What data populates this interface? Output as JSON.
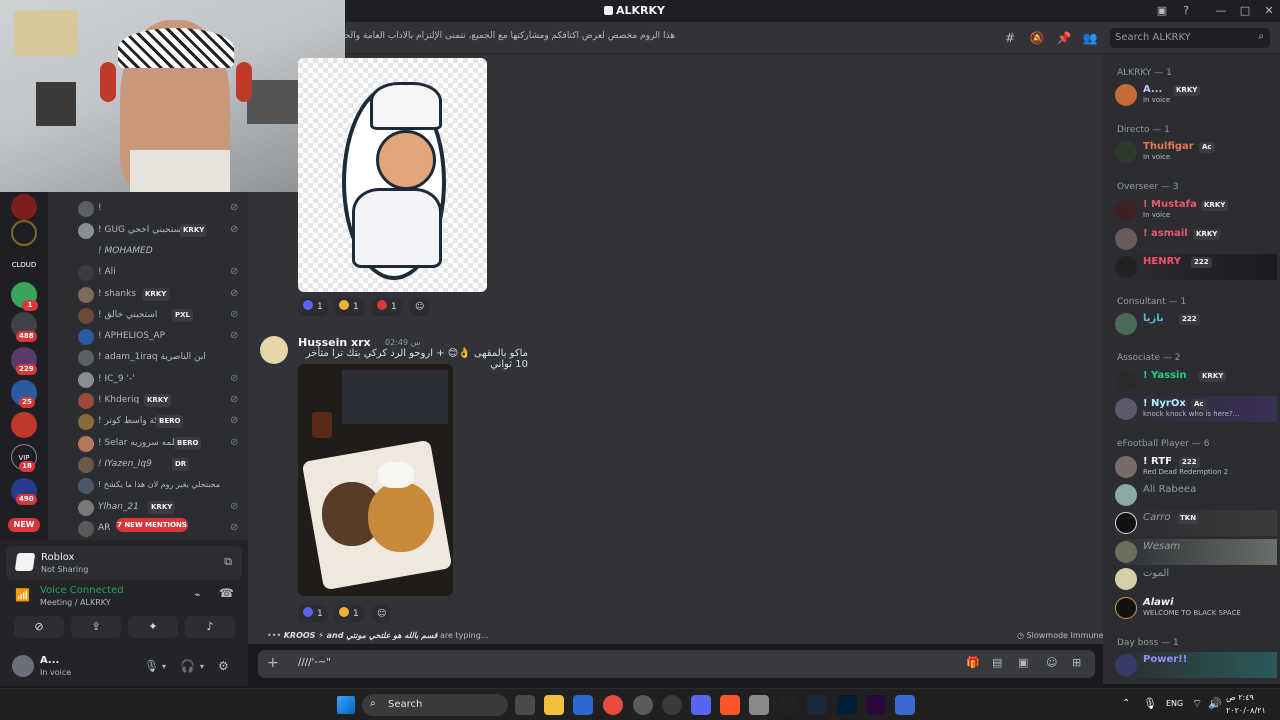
{
  "window": {
    "title": "ALKRKY"
  },
  "header": {
    "topic": "هذا الروم مخصص لعرض اكتافكم ومشاركتها مع الجميع، نتمنى الإلتزام بالآداب العامة والحفاظ على جودة المحتوى",
    "search_placeholder": "Search ALKRKY"
  },
  "guilds": {
    "badges": [
      "1",
      "488",
      "229",
      "25",
      "18",
      "490"
    ],
    "labels": [
      "CLOUD",
      "VIP"
    ],
    "new_label": "NEW"
  },
  "voice_users": [
    {
      "name": "!",
      "tag": ""
    },
    {
      "name": "! GUG استحبني اخحي",
      "tag": "KRKY"
    },
    {
      "name": "! MOHAMED",
      "tag": ""
    },
    {
      "name": "! Ali",
      "tag": ""
    },
    {
      "name": "! shanks",
      "tag": "KRKY"
    },
    {
      "name": "! استحبني خالق",
      "tag": "PXL"
    },
    {
      "name": "! APHELIOS_AP",
      "tag": ""
    },
    {
      "name": "! adam_1iraq ابن الناصرية",
      "tag": ""
    },
    {
      "name": "! IC_9 '-'",
      "tag": ""
    },
    {
      "name": "! Khderiq",
      "tag": "KRKY"
    },
    {
      "name": "! ملكة واسط كوتر",
      "tag": "BERO"
    },
    {
      "name": "! Selar كلمه سروريه",
      "tag": "BERO"
    },
    {
      "name": "! IYazen_Iq9",
      "tag": "DR"
    },
    {
      "name": "! محبتحلي يغير روم لان هذا ما يكشخ",
      "tag": ""
    },
    {
      "name": "Ylhan_21",
      "tag": "KRKY"
    },
    {
      "name": "AR",
      "tag": ""
    }
  ],
  "mentions_pill": "7 NEW MENTIONS",
  "panel": {
    "activity_name": "Roblox",
    "activity_sub": "Not Sharing",
    "voice_status": "Voice Connected",
    "voice_path": "Meeting / ALKRKY",
    "user_name": "A...",
    "user_status": "In voice"
  },
  "messages": {
    "reactions_1": [
      {
        "emoji": "blue",
        "count": "1"
      },
      {
        "emoji": "laugh",
        "count": "1"
      },
      {
        "emoji": "heart",
        "count": "1"
      }
    ],
    "author": "Hussein xrx",
    "time": "س 02:49",
    "text": "ماكو بالمقهى 👌😊 + اروحو الرد كركي بتك ترا متأخر 10 ثواني",
    "reactions_2": [
      {
        "emoji": "blue",
        "count": "1"
      },
      {
        "emoji": "laugh",
        "count": "1"
      }
    ],
    "typing_names": "KROOS ⚡ and قسم بالله هو علتحي مونتي",
    "typing_suffix": "are typing...",
    "slowmode": "Slowmode Immune",
    "composer_value": "////'-~\""
  },
  "members": {
    "roles": [
      {
        "name": "ALKRKY — 1"
      },
      {
        "name": "Directo — 1"
      },
      {
        "name": "Overseer — 3"
      },
      {
        "name": "Consultant — 1"
      },
      {
        "name": "Associate — 2"
      },
      {
        "name": "eFootball Player — 6"
      },
      {
        "name": "Day boss — 1"
      }
    ],
    "list": [
      {
        "name": "A...",
        "tag": "KRKY",
        "sub": "In voice",
        "color": "#b5c7ff"
      },
      {
        "name": "Thulfigar",
        "tag": "Ac",
        "sub": "In voice",
        "color": "#e07a55"
      },
      {
        "name": "! Mustafa",
        "tag": "KRKY",
        "sub": "In voice",
        "color": "#f0566c"
      },
      {
        "name": "! asmail",
        "tag": "KRKY",
        "sub": "",
        "color": "#f0566c"
      },
      {
        "name": "HENRY",
        "tag": "222",
        "sub": "",
        "color": "#ff4e6b"
      },
      {
        "name": "بازيا",
        "tag": "222",
        "sub": "",
        "color": "#5fb7e8"
      },
      {
        "name": "! Yassin",
        "tag": "KRKY",
        "sub": "",
        "color": "#23d18b"
      },
      {
        "name": "! NyrOx",
        "tag": "Ac",
        "sub": "knock knock who is here?...",
        "color": "#b2f0ff"
      },
      {
        "name": "! RTF",
        "tag": "222",
        "sub": "Red Dead Redemption 2",
        "color": "#f2f3f5"
      },
      {
        "name": "Ali Rabeea",
        "tag": "",
        "sub": "",
        "color": "#949ba4"
      },
      {
        "name": "Carro",
        "tag": "TKN",
        "sub": "",
        "color": "#949ba4"
      },
      {
        "name": "Wesam",
        "tag": "",
        "sub": "",
        "color": "#949ba4"
      },
      {
        "name": "الموت",
        "tag": "",
        "sub": "",
        "color": "#949ba4"
      },
      {
        "name": "Alawi",
        "tag": "",
        "sub": "WELCOME TO BLACK SPACE",
        "color": "#f2f3f5"
      },
      {
        "name": "Power!!",
        "tag": "",
        "sub": "",
        "color": "#9b8cff"
      }
    ]
  },
  "taskbar": {
    "search_placeholder": "Search",
    "lang": "ENG",
    "time": "٢:٤٩ ص",
    "date": "٢٠٢٠/٠٨/٢١"
  },
  "colors": {
    "accent": "#5865f2",
    "danger": "#da373c",
    "online": "#23a55a"
  }
}
